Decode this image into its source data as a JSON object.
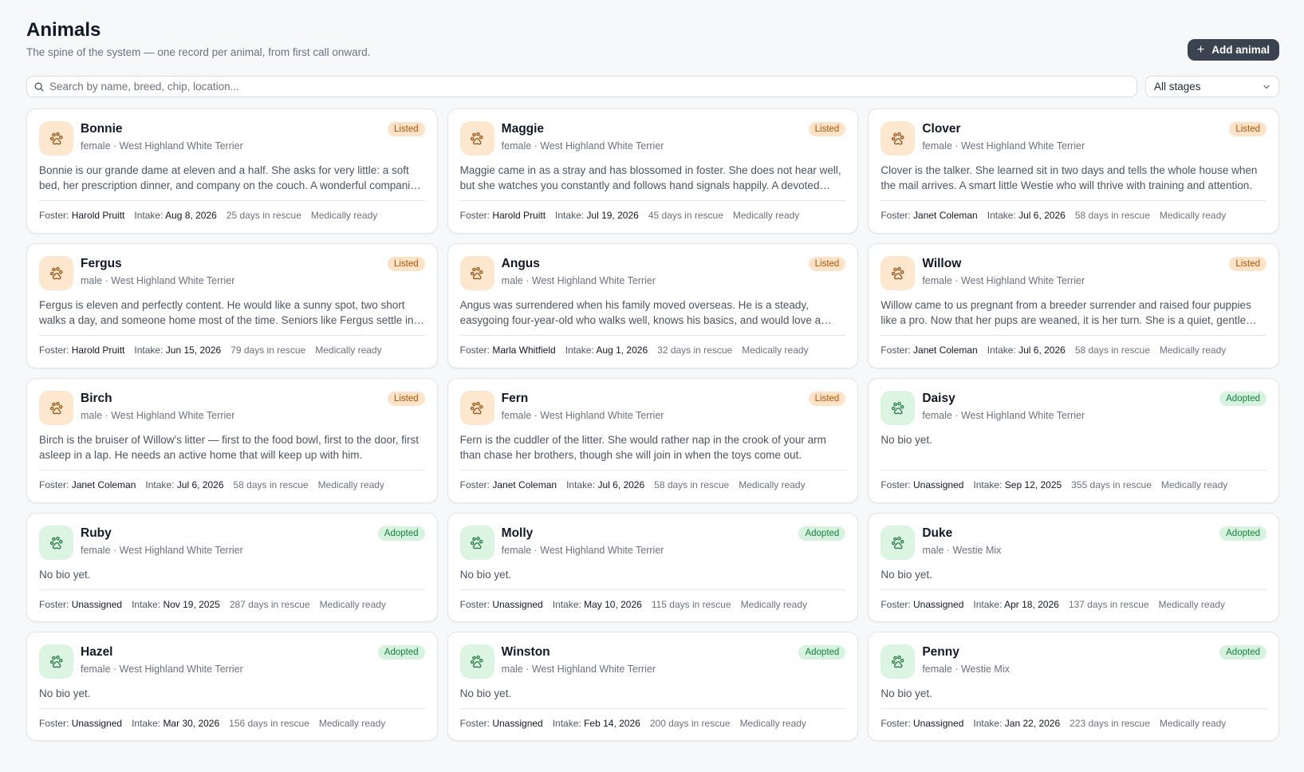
{
  "header": {
    "title": "Animals",
    "subtitle": "The spine of the system — one record per animal, from first call onward.",
    "add_button_label": "Add animal"
  },
  "search": {
    "placeholder": "Search by name, breed, chip, location..."
  },
  "stage_filter": {
    "selected": "All stages"
  },
  "labels": {
    "foster": "Foster:",
    "intake": "Intake:"
  },
  "colors": {
    "primary_button": "#3b4350",
    "listed_badge_bg": "#fde4c8",
    "listed_badge_text": "#b45309",
    "adopted_badge_bg": "#d7f3df",
    "adopted_badge_text": "#15803d"
  },
  "animals": [
    {
      "name": "Bonnie",
      "status": "Listed",
      "meta": "female · West Highland White Terrier",
      "bio": "Bonnie is our grande dame at eleven and a half. She asks for very little: a soft bed, her prescription dinner, and company on the couch. A wonderful companion for a quiet home.",
      "foster": "Harold Pruitt",
      "intake": "Aug 8, 2026",
      "days": "25 days in rescue",
      "medical": "Medically ready"
    },
    {
      "name": "Maggie",
      "status": "Listed",
      "meta": "female · West Highland White Terrier",
      "bio": "Maggie came in as a stray and has blossomed in foster. She does not hear well, but she watches you constantly and follows hand signals happily. A devoted shadow.",
      "foster": "Harold Pruitt",
      "intake": "Jul 19, 2026",
      "days": "45 days in rescue",
      "medical": "Medically ready"
    },
    {
      "name": "Clover",
      "status": "Listed",
      "meta": "female · West Highland White Terrier",
      "bio": "Clover is the talker. She learned sit in two days and tells the whole house when the mail arrives. A smart little Westie who will thrive with training and attention.",
      "foster": "Janet Coleman",
      "intake": "Jul 6, 2026",
      "days": "58 days in rescue",
      "medical": "Medically ready"
    },
    {
      "name": "Fergus",
      "status": "Listed",
      "meta": "male · West Highland White Terrier",
      "bio": "Fergus is eleven and perfectly content. He would like a sunny spot, two short walks a day, and someone home most of the time. Seniors like Fergus settle in fast.",
      "foster": "Harold Pruitt",
      "intake": "Jun 15, 2026",
      "days": "79 days in rescue",
      "medical": "Medically ready"
    },
    {
      "name": "Angus",
      "status": "Listed",
      "meta": "male · West Highland White Terrier",
      "bio": "Angus was surrendered when his family moved overseas. He is a steady, easygoing four-year-old who walks well, knows his basics, and would love a family of his own.",
      "foster": "Marla Whitfield",
      "intake": "Aug 1, 2026",
      "days": "32 days in rescue",
      "medical": "Medically ready"
    },
    {
      "name": "Willow",
      "status": "Listed",
      "meta": "female · West Highland White Terrier",
      "bio": "Willow came to us pregnant from a breeder surrender and raised four puppies like a pro. Now that her pups are weaned, it is her turn. She is a quiet, gentle soul.",
      "foster": "Janet Coleman",
      "intake": "Jul 6, 2026",
      "days": "58 days in rescue",
      "medical": "Medically ready"
    },
    {
      "name": "Birch",
      "status": "Listed",
      "meta": "male · West Highland White Terrier",
      "bio": "Birch is the bruiser of Willow's litter — first to the food bowl, first to the door, first asleep in a lap. He needs an active home that will keep up with him.",
      "foster": "Janet Coleman",
      "intake": "Jul 6, 2026",
      "days": "58 days in rescue",
      "medical": "Medically ready"
    },
    {
      "name": "Fern",
      "status": "Listed",
      "meta": "female · West Highland White Terrier",
      "bio": "Fern is the cuddler of the litter. She would rather nap in the crook of your arm than chase her brothers, though she will join in when the toys come out.",
      "foster": "Janet Coleman",
      "intake": "Jul 6, 2026",
      "days": "58 days in rescue",
      "medical": "Medically ready"
    },
    {
      "name": "Daisy",
      "status": "Adopted",
      "meta": "female · West Highland White Terrier",
      "bio": "No bio yet.",
      "foster": "Unassigned",
      "intake": "Sep 12, 2025",
      "days": "355 days in rescue",
      "medical": "Medically ready"
    },
    {
      "name": "Ruby",
      "status": "Adopted",
      "meta": "female · West Highland White Terrier",
      "bio": "No bio yet.",
      "foster": "Unassigned",
      "intake": "Nov 19, 2025",
      "days": "287 days in rescue",
      "medical": "Medically ready"
    },
    {
      "name": "Molly",
      "status": "Adopted",
      "meta": "female · West Highland White Terrier",
      "bio": "No bio yet.",
      "foster": "Unassigned",
      "intake": "May 10, 2026",
      "days": "115 days in rescue",
      "medical": "Medically ready"
    },
    {
      "name": "Duke",
      "status": "Adopted",
      "meta": "male · Westie Mix",
      "bio": "No bio yet.",
      "foster": "Unassigned",
      "intake": "Apr 18, 2026",
      "days": "137 days in rescue",
      "medical": "Medically ready"
    },
    {
      "name": "Hazel",
      "status": "Adopted",
      "meta": "female · West Highland White Terrier",
      "bio": "No bio yet.",
      "foster": "Unassigned",
      "intake": "Mar 30, 2026",
      "days": "156 days in rescue",
      "medical": "Medically ready"
    },
    {
      "name": "Winston",
      "status": "Adopted",
      "meta": "male · West Highland White Terrier",
      "bio": "No bio yet.",
      "foster": "Unassigned",
      "intake": "Feb 14, 2026",
      "days": "200 days in rescue",
      "medical": "Medically ready"
    },
    {
      "name": "Penny",
      "status": "Adopted",
      "meta": "female · Westie Mix",
      "bio": "No bio yet.",
      "foster": "Unassigned",
      "intake": "Jan 22, 2026",
      "days": "223 days in rescue",
      "medical": "Medically ready"
    }
  ]
}
